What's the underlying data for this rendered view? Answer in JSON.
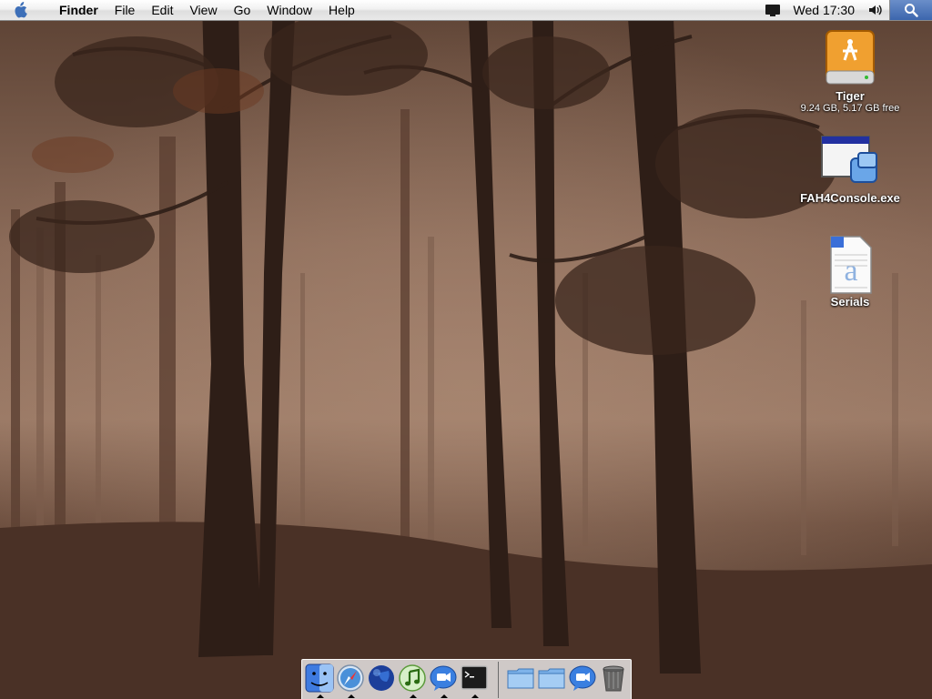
{
  "menubar": {
    "apple_icon": "apple-icon",
    "app_name": "Finder",
    "menus": [
      "File",
      "Edit",
      "View",
      "Go",
      "Window",
      "Help"
    ],
    "clock": "Wed 17:30",
    "status_icons": [
      "display-mirror-icon",
      "volume-icon"
    ],
    "spotlight_icon": "spotlight-search-icon"
  },
  "desktop": {
    "icons": [
      {
        "label": "Tiger",
        "sublabel": "9.24 GB, 5.17 GB free",
        "icon": "firewire-drive-icon"
      },
      {
        "label": "FAH4Console.exe",
        "sublabel": "",
        "icon": "windows-exe-icon"
      },
      {
        "label": "Serials",
        "sublabel": "",
        "icon": "text-document-icon"
      }
    ]
  },
  "dock": {
    "apps": [
      {
        "name": "Finder",
        "icon": "finder-icon",
        "running": true
      },
      {
        "name": "Safari",
        "icon": "safari-icon",
        "running": true
      },
      {
        "name": "Network",
        "icon": "globe-icon",
        "running": false
      },
      {
        "name": "iTunes",
        "icon": "itunes-icon",
        "running": true
      },
      {
        "name": "iChat",
        "icon": "ichat-icon",
        "running": true
      },
      {
        "name": "Terminal",
        "icon": "terminal-icon",
        "running": true
      }
    ],
    "others": [
      {
        "name": "Folder",
        "icon": "folder-icon"
      },
      {
        "name": "Folder",
        "icon": "folder-icon"
      },
      {
        "name": "iChat",
        "icon": "ichat-icon"
      },
      {
        "name": "Trash",
        "icon": "trash-icon"
      }
    ]
  }
}
